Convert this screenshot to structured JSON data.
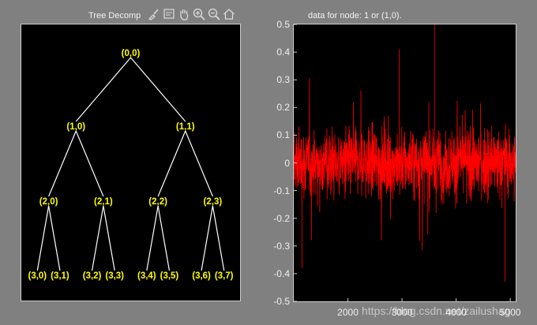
{
  "left_axes": {
    "title": "Tree Decomp",
    "nodes": [
      {
        "id": "n00",
        "label": "(0,0)"
      },
      {
        "id": "n10",
        "label": "(1,0)"
      },
      {
        "id": "n11",
        "label": "(1,1)"
      },
      {
        "id": "n20",
        "label": "(2,0)"
      },
      {
        "id": "n21",
        "label": "(2,1)"
      },
      {
        "id": "n22",
        "label": "(2,2)"
      },
      {
        "id": "n23",
        "label": "(2,3)"
      },
      {
        "id": "n30",
        "label": "(3,0)"
      },
      {
        "id": "n31",
        "label": "(3,1)"
      },
      {
        "id": "n32",
        "label": "(3,2)"
      },
      {
        "id": "n33",
        "label": "(3,3)"
      },
      {
        "id": "n34",
        "label": "(3,4)"
      },
      {
        "id": "n35",
        "label": "(3,5)"
      },
      {
        "id": "n36",
        "label": "(3,6)"
      },
      {
        "id": "n37",
        "label": "(3,7)"
      }
    ],
    "edges": [
      [
        "n00",
        "n10"
      ],
      [
        "n00",
        "n11"
      ],
      [
        "n10",
        "n20"
      ],
      [
        "n10",
        "n21"
      ],
      [
        "n11",
        "n22"
      ],
      [
        "n11",
        "n23"
      ],
      [
        "n20",
        "n30"
      ],
      [
        "n20",
        "n31"
      ],
      [
        "n21",
        "n32"
      ],
      [
        "n21",
        "n33"
      ],
      [
        "n22",
        "n34"
      ],
      [
        "n22",
        "n35"
      ],
      [
        "n23",
        "n36"
      ],
      [
        "n23",
        "n37"
      ]
    ]
  },
  "toolbar": {
    "icons": [
      "brush-icon",
      "data-cursor-icon",
      "pan-hand-icon",
      "zoom-in-icon",
      "zoom-out-icon",
      "home-icon"
    ]
  },
  "right_axes": {
    "title": "data for node: 1 or (1,0)."
  },
  "chart_data": {
    "type": "line",
    "title": "data for node: 1 or (1,0).",
    "xlabel": "",
    "ylabel": "",
    "ylim": [
      -0.5,
      0.5
    ],
    "xlim": [
      1000,
      5100
    ],
    "yticks": [
      "0.5",
      "0.4",
      "0.3",
      "0.2",
      "0.1",
      "0",
      "-0.1",
      "-0.2",
      "-0.3",
      "-0.4",
      "-0.5"
    ],
    "ytick_values": [
      0.5,
      0.4,
      0.3,
      0.2,
      0.1,
      0,
      -0.1,
      -0.2,
      -0.3,
      -0.4,
      -0.5
    ],
    "xticks": [
      "2000",
      "3000",
      "4000",
      "5000"
    ],
    "xtick_values": [
      2000,
      3000,
      4000,
      5000
    ],
    "grid": false,
    "series": [
      {
        "color": "#ff0000",
        "description_values": {
          "n_points": 4100,
          "typical_amplitude": 0.12,
          "max": 0.5,
          "min": -0.43
        }
      }
    ],
    "colors": {
      "background": "#000000",
      "line": "#ff0000"
    }
  },
  "watermark": "https://blog.csdn.net/zailushag",
  "colors": {
    "figure_bg": "#808080",
    "node_label": "#ffff00",
    "edge": "#ffffff"
  }
}
